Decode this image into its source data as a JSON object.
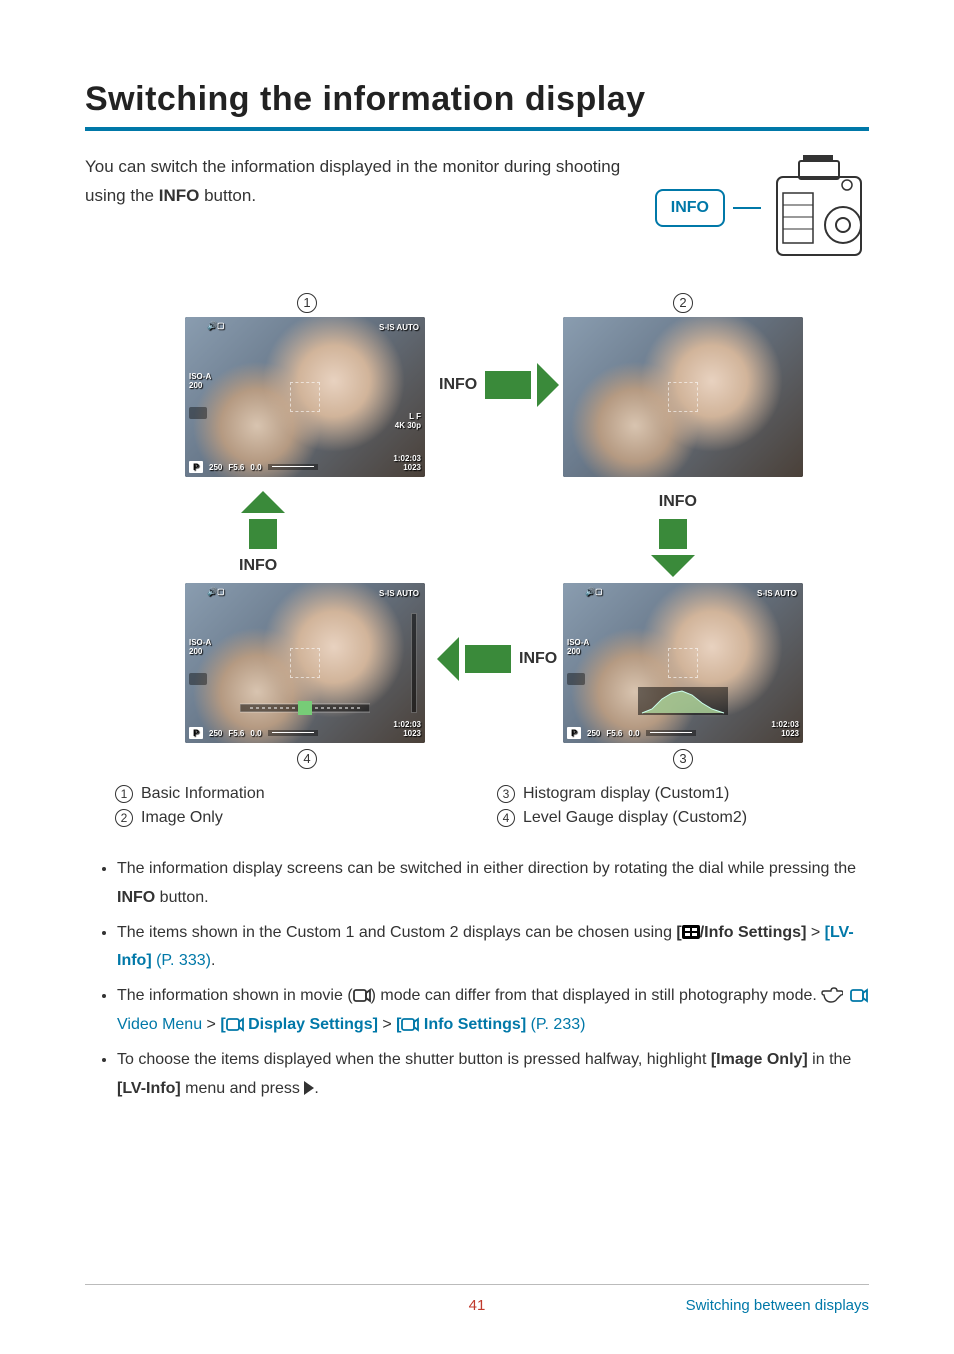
{
  "title": "Switching the information display",
  "intro": {
    "pre": "You can switch the information displayed in the monitor during shooting using the ",
    "button_word": "INFO",
    "post": " button."
  },
  "info_label": "INFO",
  "circles": {
    "n1": "1",
    "n2": "2",
    "n3": "3",
    "n4": "4"
  },
  "arrows": {
    "a1": "INFO",
    "a2": "INFO",
    "a3": "INFO",
    "a4": "INFO"
  },
  "osd": {
    "top_icons": "🔊▢",
    "topr": "S-IS AUTO",
    "iso_label": "ISO-A",
    "iso_val": "200",
    "mode": "P",
    "shutter": "250",
    "aperture": "F5.6",
    "ev": "0.0",
    "time": "1:02:03",
    "shots": "1023",
    "quality1": "L F",
    "quality2": "4K 30p"
  },
  "legend": {
    "l1": "Basic Information",
    "l2": "Image Only",
    "l3": "Histogram display (Custom1)",
    "l4": "Level Gauge display (Custom2)"
  },
  "notes": {
    "n1a": "The information display screens can be switched in either direction by rotating the dial while pressing the ",
    "n1b": "INFO",
    "n1c": " button.",
    "n2a": "The items shown in the Custom 1 and Custom 2 displays can be chosen using ",
    "n2b": "/Info Settings]",
    "n2c": " > ",
    "n2d": "[LV-Info]",
    "n2e": " (P. 333)",
    "n2f": ".",
    "n3a": "The information shown in movie (",
    "n3b": ") mode can differ from that displayed in still photography mode. ",
    "n3c": " Video Menu",
    "n3d": " > ",
    "n3e": " Display Settings]",
    "n3f": " > ",
    "n3g": " Info Settings]",
    "n3h": " (P. 233)",
    "n4a": "To choose the items displayed when the shutter button is pressed halfway, highlight ",
    "n4b": "[Image Only]",
    "n4c": " in the ",
    "n4d": "[LV-Info]",
    "n4e": " menu and press ",
    "n4f": "."
  },
  "footer": {
    "page": "41",
    "link": "Switching between displays"
  }
}
